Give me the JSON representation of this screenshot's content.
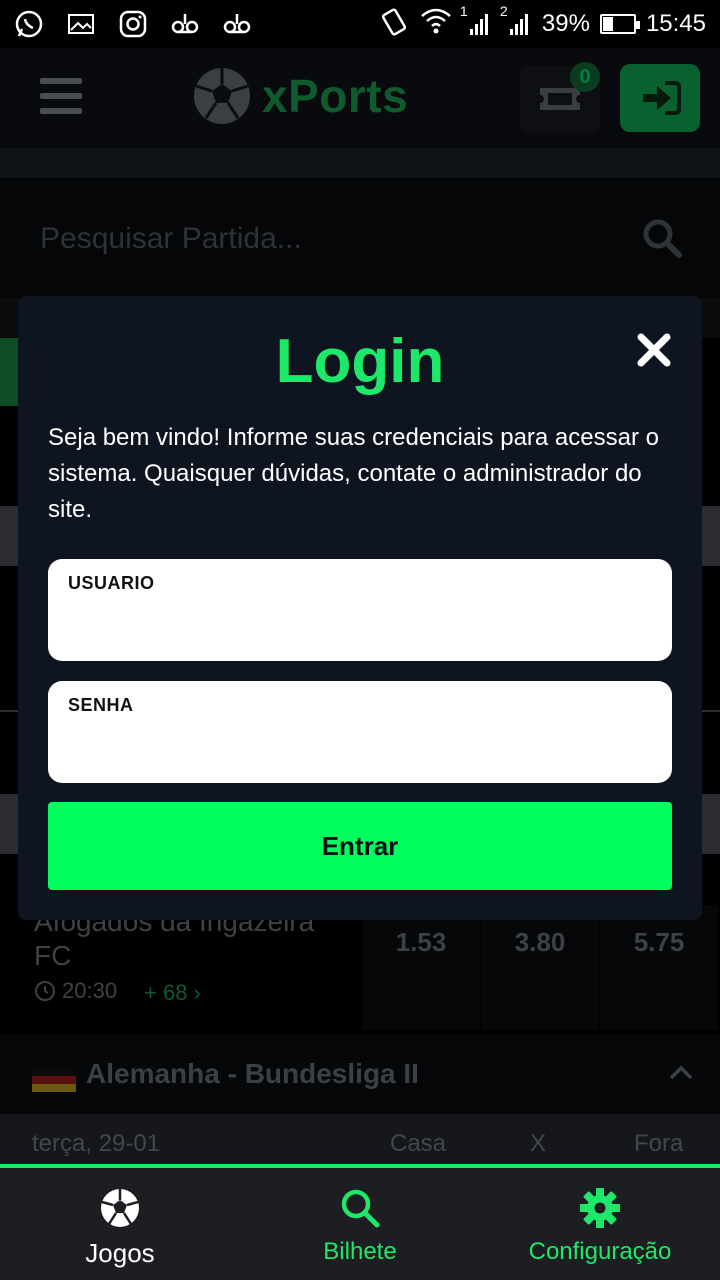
{
  "status_bar": {
    "left_icons": [
      "whatsapp-icon",
      "gallery-icon",
      "instagram-icon",
      "voicemail-icon",
      "voicemail-icon"
    ],
    "sim1": "1",
    "sim2": "2",
    "battery_percent": "39%",
    "battery_level": 0.39,
    "time": "15:45"
  },
  "header": {
    "logo_text": "xPorts",
    "ticket_count": "0"
  },
  "search": {
    "placeholder": "Pesquisar Partida..."
  },
  "background_match": {
    "team": "Afogados da Ingazeira FC",
    "time": "20:30",
    "more_markets": "+ 68",
    "odds": [
      "1.53",
      "3.80",
      "5.75"
    ]
  },
  "league": {
    "name": "Alemanha - Bundesliga II",
    "date": "terça, 29-01",
    "col_home": "Casa",
    "col_draw": "X",
    "col_away": "Fora"
  },
  "modal": {
    "title": "Login",
    "description": "Seja bem vindo! Informe suas credenciais para acessar o sistema. Quaisquer dúvidas, contate o administrador do site.",
    "user_label": "USUARIO",
    "user_value": "",
    "password_label": "SENHA",
    "password_value": "",
    "submit_label": "Entrar"
  },
  "bottom_nav": {
    "items": [
      {
        "label": "Jogos",
        "icon": "soccer-ball-icon",
        "color": "#ffffff"
      },
      {
        "label": "Bilhete",
        "icon": "search-icon",
        "color": "#1ee86a"
      },
      {
        "label": "Configuração",
        "icon": "gear-icon",
        "color": "#1ee86a"
      }
    ]
  },
  "colors": {
    "accent": "#1ee86a",
    "button": "#00ff5e",
    "modal_bg": "#0f1520"
  }
}
